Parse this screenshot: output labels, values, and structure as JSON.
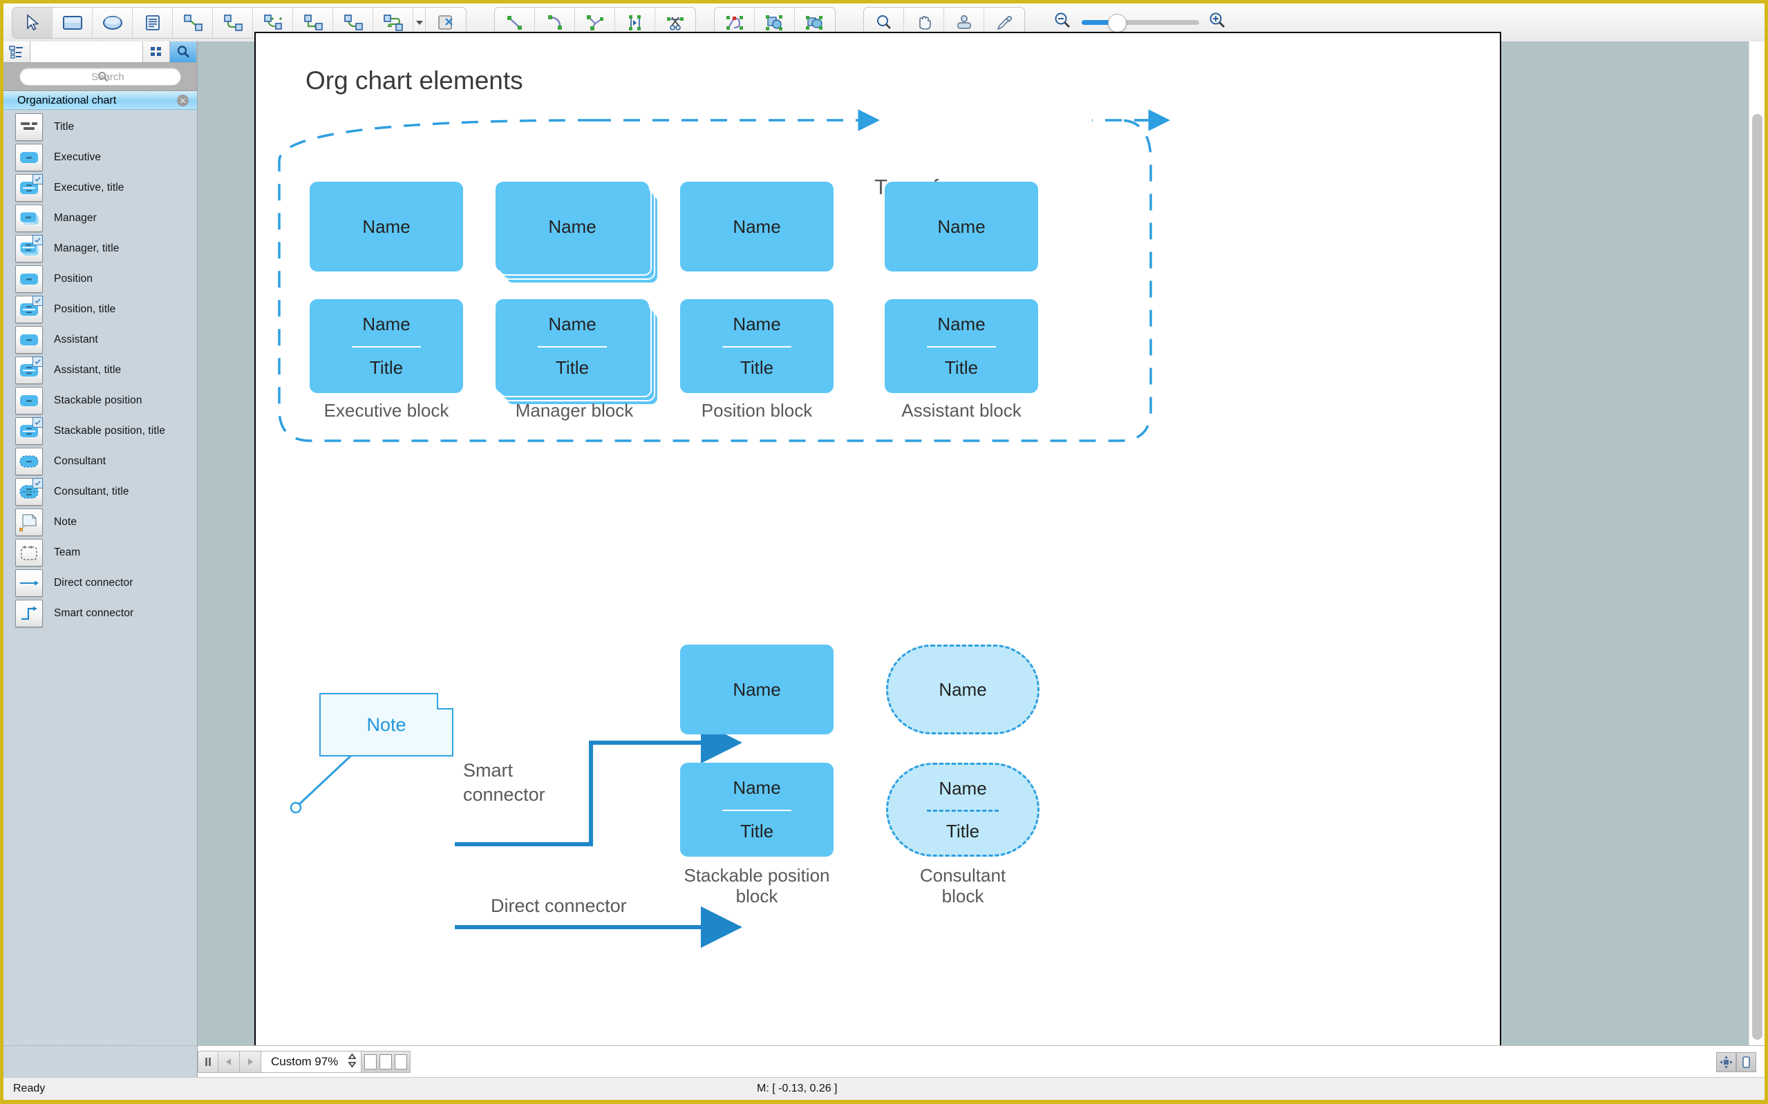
{
  "toolbar": {
    "groups": [
      {
        "name": "tools",
        "buttons": [
          {
            "icon": "pointer-icon",
            "label": "Select"
          },
          {
            "icon": "rectangle-icon",
            "label": "Rectangle"
          },
          {
            "icon": "ellipse-icon",
            "label": "Ellipse"
          },
          {
            "icon": "text-icon",
            "label": "Text"
          },
          {
            "icon": "direct-connector-icon",
            "label": "Direct connector"
          },
          {
            "icon": "curve-connector-icon",
            "label": "Curve connector"
          },
          {
            "icon": "tree-connector-icon",
            "label": "Tree connector"
          },
          {
            "icon": "right-angle-connector-icon",
            "label": "Right-angle connector"
          },
          {
            "icon": "rounded-connector-icon",
            "label": "Rounded connector"
          },
          {
            "icon": "smart-connector-icon",
            "label": "Smart connector"
          }
        ]
      },
      {
        "name": "paste-special",
        "buttons": [
          {
            "icon": "paste-special-icon",
            "label": "Paste special"
          }
        ]
      },
      {
        "name": "path-tools",
        "buttons": [
          {
            "icon": "line-segment-icon",
            "label": "Line segment"
          },
          {
            "icon": "arc-segment-icon",
            "label": "Arc segment"
          },
          {
            "icon": "add-node-icon",
            "label": "Add node"
          },
          {
            "icon": "split-node-icon",
            "label": "Split node"
          },
          {
            "icon": "scissors-icon",
            "label": "Cut path"
          }
        ]
      },
      {
        "name": "shape-ops",
        "buttons": [
          {
            "icon": "edit-path-icon",
            "label": "Edit path"
          },
          {
            "icon": "union-shapes-icon",
            "label": "Union shapes"
          },
          {
            "icon": "merge-shapes-icon",
            "label": "Merge shapes"
          }
        ]
      },
      {
        "name": "view-tools",
        "buttons": [
          {
            "icon": "zoom-icon",
            "label": "Zoom"
          },
          {
            "icon": "hand-icon",
            "label": "Pan"
          },
          {
            "icon": "stamp-icon",
            "label": "Format painter"
          },
          {
            "icon": "eyedropper-icon",
            "label": "Eyedropper"
          }
        ]
      }
    ],
    "zoom_out_icon": "zoom-out-icon",
    "zoom_in_icon": "zoom-in-icon",
    "zoom_slider_value": 28
  },
  "left_panel": {
    "tabs": [
      {
        "icon": "tree-view-icon",
        "active": false
      },
      {
        "icon": "grid-view-icon",
        "active": false
      },
      {
        "icon": "search-view-icon",
        "active": true
      }
    ],
    "search": {
      "placeholder": "Search",
      "value": "",
      "icon": "search-icon"
    },
    "library": {
      "title": "Organizational chart",
      "close_icon": "close-icon"
    },
    "items": [
      {
        "label": "Title",
        "icon": "title-shape-icon",
        "kind": "title"
      },
      {
        "label": "Executive",
        "icon": "executive-shape-icon",
        "kind": "plain"
      },
      {
        "label": "Executive, title",
        "icon": "executive-title-shape-icon",
        "kind": "plain-title",
        "ticked": true
      },
      {
        "label": "Manager",
        "icon": "manager-shape-icon",
        "kind": "stack"
      },
      {
        "label": "Manager, title",
        "icon": "manager-title-shape-icon",
        "kind": "stack-title",
        "ticked": true
      },
      {
        "label": "Position",
        "icon": "position-shape-icon",
        "kind": "plain"
      },
      {
        "label": "Position, title",
        "icon": "position-title-shape-icon",
        "kind": "plain-title",
        "ticked": true
      },
      {
        "label": "Assistant",
        "icon": "assistant-shape-icon",
        "kind": "plain"
      },
      {
        "label": "Assistant, title",
        "icon": "assistant-title-shape-icon",
        "kind": "plain-title",
        "ticked": true
      },
      {
        "label": "Stackable position",
        "icon": "stackable-position-shape-icon",
        "kind": "plain"
      },
      {
        "label": "Stackable position, title",
        "icon": "stackable-position-title-shape-icon",
        "kind": "plain-title",
        "ticked": true
      },
      {
        "label": "Consultant",
        "icon": "consultant-shape-icon",
        "kind": "oval"
      },
      {
        "label": "Consultant, title",
        "icon": "consultant-title-shape-icon",
        "kind": "oval-title",
        "ticked": true
      },
      {
        "label": "Note",
        "icon": "note-shape-icon",
        "kind": "note"
      },
      {
        "label": "Team",
        "icon": "team-shape-icon",
        "kind": "team"
      },
      {
        "label": "Direct connector",
        "icon": "direct-connector-shape-icon",
        "kind": "direct"
      },
      {
        "label": "Smart connector",
        "icon": "smart-connector-shape-icon",
        "kind": "smart"
      }
    ],
    "watermark": "www.heritagechristiancollege.com"
  },
  "canvas": {
    "title": "Org chart elements",
    "team_frame_label": "Team frame",
    "blocks": [
      {
        "name": "executive",
        "name_text": "Name",
        "title_text": "Title",
        "caption": "Executive block",
        "style": "plain"
      },
      {
        "name": "manager",
        "name_text": "Name",
        "title_text": "Title",
        "caption": "Manager block",
        "style": "stack"
      },
      {
        "name": "position",
        "name_text": "Name",
        "title_text": "Title",
        "caption": "Position block",
        "style": "plain"
      },
      {
        "name": "assistant",
        "name_text": "Name",
        "title_text": "Title",
        "caption": "Assistant block",
        "style": "plain"
      }
    ],
    "note": {
      "text": "Note"
    },
    "smart_connector_label": "Smart\nconnector",
    "direct_connector_label": "Direct connector",
    "stackable": {
      "name_text": "Name",
      "title_text": "Title",
      "caption": "Stackable position\nblock"
    },
    "consultant": {
      "name_text": "Name",
      "title_text": "Title",
      "caption": "Consultant\nblock"
    },
    "colors": {
      "block_fill": "#5ec6f5",
      "consultant_fill": "#bfe9fa",
      "accent_line": "#2e9fe0",
      "note_fill": "#eefaff",
      "caption_text": "#595959"
    }
  },
  "status_strip": {
    "pause_icon": "pause-icon",
    "prev_icon": "prev-page-icon",
    "next_icon": "next-page-icon",
    "zoom_value": "Custom 97%",
    "stepper_icon": "stepper-icon",
    "page_count": 3,
    "fit_icon": "fit-page-icon",
    "page_icon": "single-page-icon"
  },
  "status_bar": {
    "message": "Ready",
    "mouse_position": "M: [ -0.13, 0.26 ]"
  }
}
